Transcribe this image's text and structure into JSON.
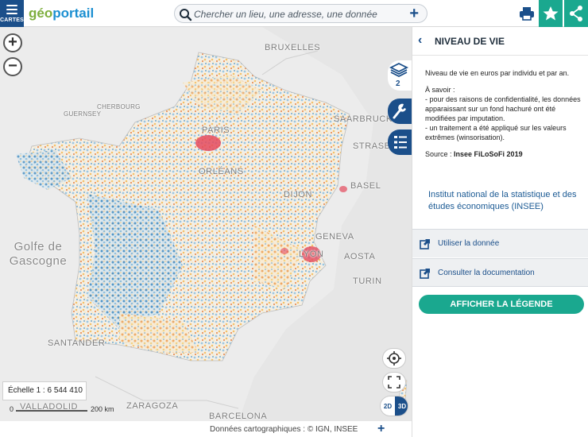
{
  "header": {
    "menu_label": "CARTES",
    "logo_part1": "géo",
    "logo_part2": "portail",
    "search_placeholder": "Chercher un lieu, une adresse, une donnée",
    "accent_color": "#1b4f8a",
    "highlight_color": "#1aa88f"
  },
  "map": {
    "labels": {
      "bruxelles": "BRUXELLES",
      "paris": "PARIS",
      "saarbrucken": "SAARBRUCKEN",
      "strasbourg": "STRASBOURG",
      "orleans": "ORLÉANS",
      "dijon": "DIJON",
      "basel": "BASEL",
      "geneva": "GENEVA",
      "aosta": "AOSTA",
      "turin": "TURIN",
      "santander": "SANTANDER",
      "zaragoza": "ZARAGOZA",
      "barcelona": "BARCELONA",
      "valladolid": "VALLADOLID",
      "golfe_line1": "Golfe de",
      "golfe_line2": "Gascogne",
      "lyon": "LYON",
      "cherbourg": "CHERBOURG",
      "guernsey": "GUERNSEY"
    },
    "layers_count": "2",
    "scale_text": "Échelle 1 : 6 544 410",
    "scalebar_zero": "0",
    "scalebar_km": "200 km",
    "mode_2d": "2D",
    "mode_3d": "3D"
  },
  "footer": {
    "attribution": "Données cartographiques : ©   IGN,  INSEE"
  },
  "panel": {
    "title": "NIVEAU DE VIE",
    "description": "Niveau de vie en euros par individu et par an.",
    "note_intro": "À savoir :",
    "note_1": "- pour des raisons de confidentialité, les données apparaissant sur un fond hachuré ont été modifiées par imputation.",
    "note_2": "- un traitement a été appliqué sur les valeurs extrêmes (winsorisation).",
    "source_label": "Source :",
    "source_value": "Insee FiLoSoFi 2019",
    "institution": "Institut national de la statistique et des études économiques (INSEE)",
    "link_use": "Utiliser la donnée",
    "link_doc": "Consulter la documentation",
    "legend_button": "AFFICHER LA LÉGENDE"
  },
  "icons": [
    "menu-icon",
    "search-icon",
    "add-icon",
    "print-icon",
    "star-icon",
    "share-icon",
    "layers-icon",
    "wrench-icon",
    "legend-list-icon",
    "locate-icon",
    "fullscreen-icon",
    "external-link-icon",
    "back-chevron-icon"
  ]
}
